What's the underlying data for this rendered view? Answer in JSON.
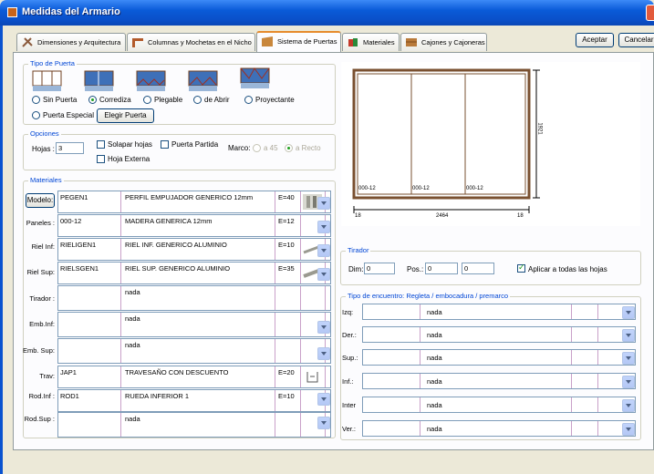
{
  "window": {
    "title": "Medidas del Armario"
  },
  "tabs": [
    {
      "label": "Dimensiones y Arquitectura",
      "icon": "tools-icon"
    },
    {
      "label": "Columnas y Mochetas en el Nicho",
      "icon": "column-icon"
    },
    {
      "label": "Sistema de Puertas",
      "icon": "door-system-icon"
    },
    {
      "label": "Materiales",
      "icon": "materials-icon"
    },
    {
      "label": "Cajones y Cajoneras",
      "icon": "drawers-icon"
    }
  ],
  "buttons": {
    "accept": "Aceptar",
    "cancel": "Cancelar"
  },
  "tipo_puerta": {
    "title": "Tipo de Puerta",
    "options": [
      "Sin Puerta",
      "Corrediza",
      "Plegable",
      "de Abrir",
      "Proyectante",
      "Puerta Especial"
    ],
    "selected": "Corrediza",
    "elegir": "Elegir Puerta"
  },
  "opciones": {
    "title": "Opciones",
    "hojas_label": "Hojas :",
    "hojas_value": "3",
    "solapar": "Solapar hojas",
    "partida": "Puerta Partida",
    "externa": "Hoja Externa",
    "marco_label": "Marco:",
    "marco_a45": "a 45",
    "marco_recto": "a Recto"
  },
  "materiales": {
    "title": "Materiales",
    "modelo_button": "Modelo:",
    "rows": [
      {
        "label": "Modelo:",
        "code": "PEGEN1",
        "desc": "PERFIL EMPUJADOR GENERICO 12mm",
        "e": "E=40",
        "thumb": "profile-thumb-icon"
      },
      {
        "label": "Paneles :",
        "code": "000-12",
        "desc": "MADERA GENERICA 12mm",
        "e": "E=12",
        "thumb": ""
      },
      {
        "label": "Riel Inf:",
        "code": "RIELIGEN1",
        "desc": "RIEL INF. GENERICO ALUMINIO",
        "e": "E=10",
        "thumb": "rail-thumb-icon"
      },
      {
        "label": "Riel Sup:",
        "code": "RIELSGEN1",
        "desc": "RIEL SUP. GENERICO ALUMINIO",
        "e": "E=35",
        "thumb": "rail-thumb-icon"
      },
      {
        "label": "Tirador :",
        "code": "",
        "desc": "nada",
        "e": "",
        "thumb": ""
      },
      {
        "label": "Emb.Inf:",
        "code": "",
        "desc": "nada",
        "e": "",
        "thumb": ""
      },
      {
        "label": "Emb. Sup:",
        "code": "",
        "desc": "nada",
        "e": "",
        "thumb": ""
      },
      {
        "label": "Trav:",
        "code": "JAP1",
        "desc": "TRAVESAÑO CON DESCUENTO",
        "e": "E=20",
        "thumb": "crossbar-thumb-icon"
      },
      {
        "label": "Rod.Inf :",
        "code": "ROD1",
        "desc": "RUEDA INFERIOR 1",
        "e": "E=10",
        "thumb": ""
      },
      {
        "label": "Rod.Sup :",
        "code": "",
        "desc": "nada",
        "e": "",
        "thumb": ""
      }
    ]
  },
  "preview": {
    "panel_labels": [
      "000-12",
      "000-12",
      "000-12"
    ],
    "width": "2464",
    "left_gap": "18",
    "right_gap": "18",
    "height": "1921"
  },
  "tirador": {
    "title": "Tirador",
    "dim_label": "Dim:",
    "dim_value": "0",
    "pos_label": "Pos.:",
    "pos_value1": "0",
    "pos_value2": "0",
    "apply_all": "Aplicar a todas las hojas"
  },
  "encuentro": {
    "title": "Tipo de encuentro: Regleta / embocadura / premarco",
    "rows": [
      {
        "label": "Izq:",
        "value": "nada"
      },
      {
        "label": "Der.:",
        "value": "nada"
      },
      {
        "label": "Sup.:",
        "value": "nada"
      },
      {
        "label": "Inf.:",
        "value": "nada"
      },
      {
        "label": "Inter",
        "value": "nada"
      },
      {
        "label": "Ver.:",
        "value": "nada"
      }
    ]
  }
}
